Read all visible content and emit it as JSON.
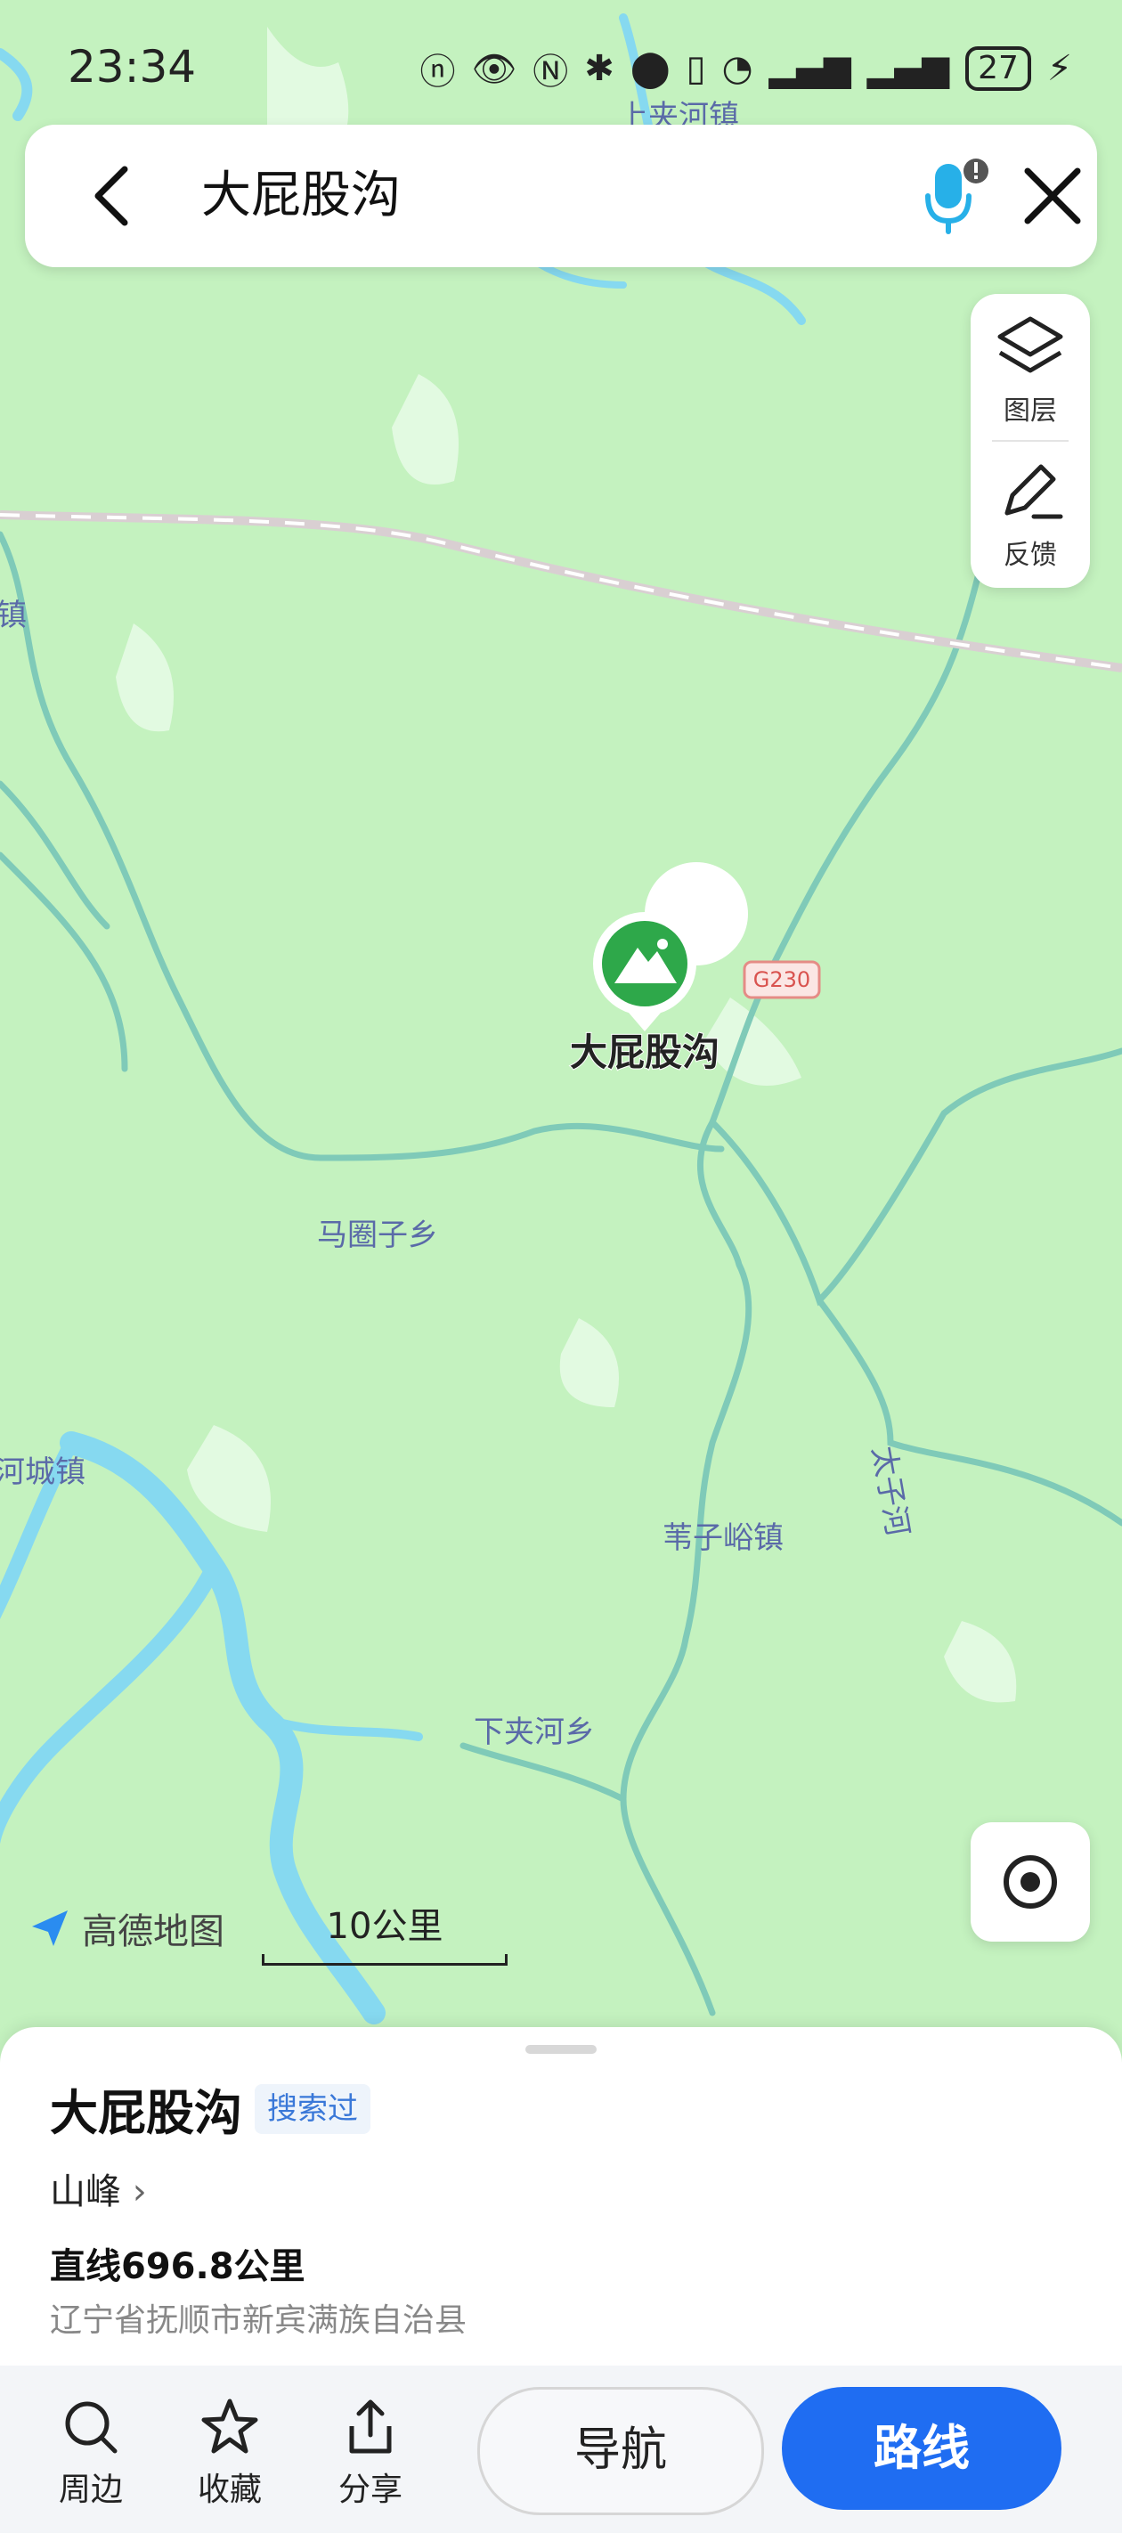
{
  "status_bar": {
    "time": "23:34",
    "battery": "27",
    "icons": [
      "nfc-data-icon",
      "eye-icon",
      "nfc-icon",
      "bluetooth-icon",
      "location-icon",
      "vibrate-icon",
      "wifi-icon",
      "signal-icon",
      "signal-icon",
      "charging-icon"
    ]
  },
  "search": {
    "query": "大屁股沟"
  },
  "tools": {
    "layers_label": "图层",
    "feedback_label": "反馈"
  },
  "map": {
    "poi_name": "大屁股沟",
    "road_badge": "G230",
    "labels": {
      "top_town": "上夹河镇",
      "left_town": "镇",
      "ma_quan": "马圈子乡",
      "he_cheng": "河城镇",
      "wei_zi_yu": "苇子峪镇",
      "xia_jia_he": "下夹河乡",
      "tai_zi_he": "太子河"
    },
    "colors": {
      "land": "#c4f2bf",
      "water": "#86d9f0",
      "road": "#7fcab8",
      "rail": "#d9cfd2",
      "poi": "#2ea84a"
    },
    "logo_text": "高德地图",
    "scale_text": "10公里"
  },
  "sheet": {
    "title": "大屁股沟",
    "badge": "搜索过",
    "category": "山峰",
    "distance": "直线696.8公里",
    "address": "辽宁省抚顺市新宾满族自治县"
  },
  "actions": {
    "nearby": "周边",
    "favorite": "收藏",
    "share": "分享",
    "navigate": "导航",
    "route": "路线"
  }
}
